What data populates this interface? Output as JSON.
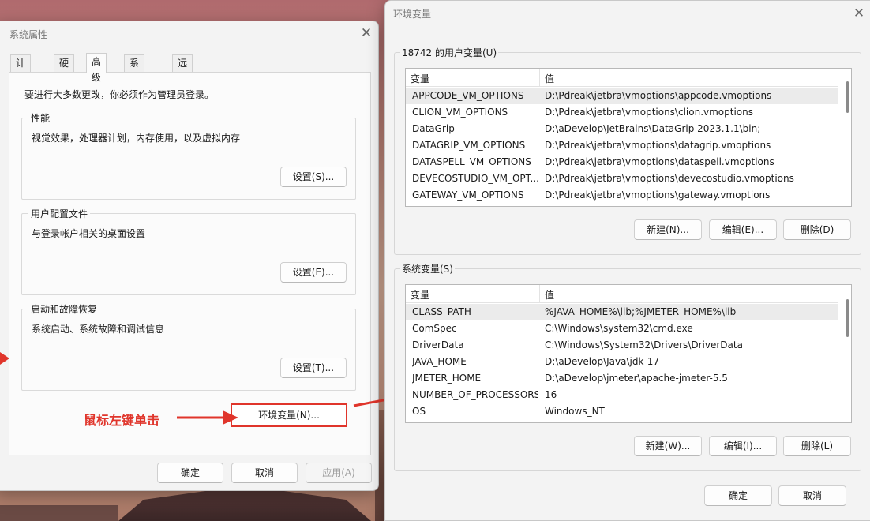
{
  "colors": {
    "annotation": "#e0352b",
    "dialog_bg": "#f3f3f3"
  },
  "sysprop": {
    "title": "系统属性",
    "tabs": [
      "计算机名",
      "硬件",
      "高级",
      "系统保护",
      "远程"
    ],
    "active_tab": "高级",
    "admin_note": "要进行大多数更改，你必须作为管理员登录。",
    "performance": {
      "label": "性能",
      "desc": "视觉效果，处理器计划，内存使用，以及虚拟内存",
      "button": "设置(S)..."
    },
    "user_profiles": {
      "label": "用户配置文件",
      "desc": "与登录帐户相关的桌面设置",
      "button": "设置(E)..."
    },
    "startup_recovery": {
      "label": "启动和故障恢复",
      "desc": "系统启动、系统故障和调试信息",
      "button": "设置(T)..."
    },
    "env_button": "环境变量(N)...",
    "ok": "确定",
    "cancel": "取消",
    "apply": "应用(A)"
  },
  "annotation": {
    "text": "鼠标左键单击"
  },
  "envvars": {
    "title": "环境变量",
    "user_group_label": "18742 的用户变量(U)",
    "headers": {
      "var": "变量",
      "val": "值"
    },
    "user_vars": [
      {
        "name": "APPCODE_VM_OPTIONS",
        "value": "D:\\Pdreak\\jetbra\\vmoptions\\appcode.vmoptions"
      },
      {
        "name": "CLION_VM_OPTIONS",
        "value": "D:\\Pdreak\\jetbra\\vmoptions\\clion.vmoptions"
      },
      {
        "name": "DataGrip",
        "value": "D:\\aDevelop\\JetBrains\\DataGrip 2023.1.1\\bin;"
      },
      {
        "name": "DATAGRIP_VM_OPTIONS",
        "value": "D:\\Pdreak\\jetbra\\vmoptions\\datagrip.vmoptions"
      },
      {
        "name": "DATASPELL_VM_OPTIONS",
        "value": "D:\\Pdreak\\jetbra\\vmoptions\\dataspell.vmoptions"
      },
      {
        "name": "DEVECOSTUDIO_VM_OPT...",
        "value": "D:\\Pdreak\\jetbra\\vmoptions\\devecostudio.vmoptions"
      },
      {
        "name": "GATEWAY_VM_OPTIONS",
        "value": "D:\\Pdreak\\jetbra\\vmoptions\\gateway.vmoptions"
      }
    ],
    "user_buttons": {
      "new": "新建(N)...",
      "edit": "编辑(E)...",
      "delete": "删除(D)"
    },
    "system_group_label": "系统变量(S)",
    "system_vars": [
      {
        "name": "CLASS_PATH",
        "value": "%JAVA_HOME%\\lib;%JMETER_HOME%\\lib"
      },
      {
        "name": "ComSpec",
        "value": "C:\\Windows\\system32\\cmd.exe"
      },
      {
        "name": "DriverData",
        "value": "C:\\Windows\\System32\\Drivers\\DriverData"
      },
      {
        "name": "JAVA_HOME",
        "value": "D:\\aDevelop\\Java\\jdk-17"
      },
      {
        "name": "JMETER_HOME",
        "value": "D:\\aDevelop\\jmeter\\apache-jmeter-5.5"
      },
      {
        "name": "NUMBER_OF_PROCESSORS",
        "value": "16"
      },
      {
        "name": "OS",
        "value": "Windows_NT"
      }
    ],
    "system_buttons": {
      "new": "新建(W)...",
      "edit": "编辑(I)...",
      "delete": "删除(L)"
    },
    "ok": "确定",
    "cancel": "取消"
  }
}
